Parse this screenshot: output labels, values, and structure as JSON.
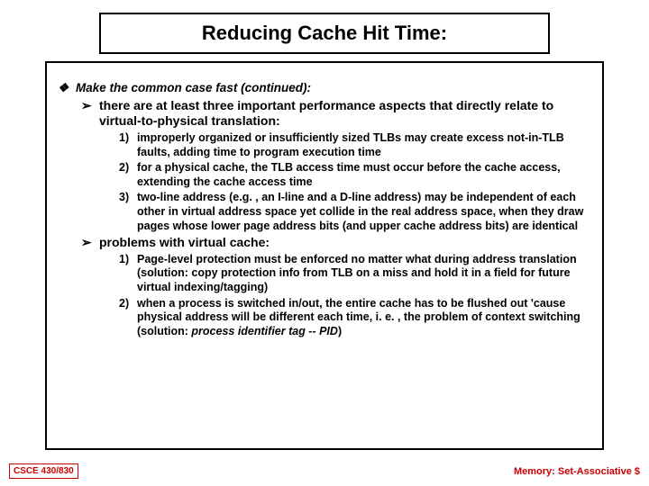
{
  "title": "Reducing Cache Hit Time:",
  "lvl1": {
    "bullet": "❖",
    "text": "Make the common case fast (continued):"
  },
  "sec1": {
    "bullet": "➢",
    "heading": "there are at least three important performance aspects that directly relate to virtual-to-physical translation:",
    "items": [
      {
        "n": "1)",
        "t": "improperly organized or insufficiently sized TLBs may create excess not-in-TLB faults, adding time to program execution time"
      },
      {
        "n": "2)",
        "t": "for a physical cache, the TLB access time must occur before the cache access, extending the cache access time"
      },
      {
        "n": "3)",
        "t": "two-line address (e.g. , an I-line and a D-line address) may be independent of each other in virtual address space yet collide in the real address space, when they draw pages whose lower page address bits (and upper cache address bits) are identical"
      }
    ]
  },
  "sec2": {
    "bullet": "➢",
    "heading": "problems with virtual cache:",
    "items": [
      {
        "n": "1)",
        "t": "Page-level protection must be enforced no matter what during address translation (solution: copy protection info from TLB on a miss and hold it in a field for future virtual indexing/tagging)"
      },
      {
        "n": "2)",
        "pre": "when a process is switched in/out, the entire cache has to be flushed out 'cause physical address will be different each time, i. e. , the problem of context switching (solution: ",
        "em": "process identifier tag -- PID",
        "post": ")"
      }
    ]
  },
  "footer": {
    "left": "CSCE 430/830",
    "right": "Memory: Set-Associative $"
  }
}
